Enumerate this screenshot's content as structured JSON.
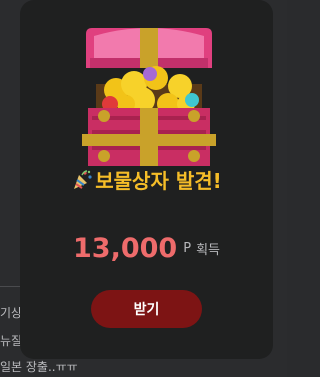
{
  "background": {
    "lines": [
      "기상",
      "뉴질",
      "일본 장출..ㅠㅠ"
    ]
  },
  "modal": {
    "title": "보물상자 발견!",
    "points_value": "13,000",
    "points_unit": "P",
    "points_suffix": "획득",
    "button_label": "받기",
    "icons": {
      "chest": "treasure-chest-icon",
      "party": "party-popper-icon"
    },
    "colors": {
      "title": "#f5bd28",
      "points": "#ee6b6b",
      "button": "#7d1414",
      "panel": "#1f2020"
    }
  }
}
